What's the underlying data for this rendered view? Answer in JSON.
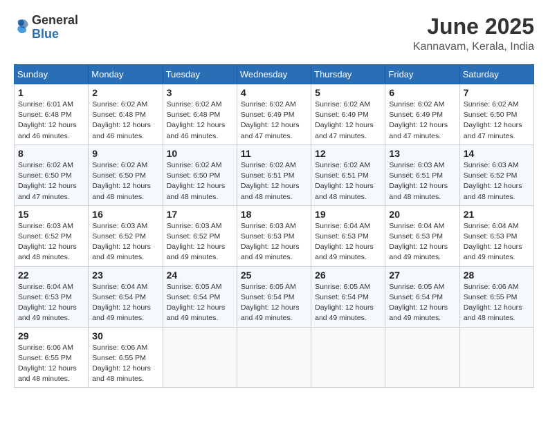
{
  "logo": {
    "general": "General",
    "blue": "Blue"
  },
  "header": {
    "month": "June 2025",
    "location": "Kannavam, Kerala, India"
  },
  "weekdays": [
    "Sunday",
    "Monday",
    "Tuesday",
    "Wednesday",
    "Thursday",
    "Friday",
    "Saturday"
  ],
  "weeks": [
    [
      {
        "day": "1",
        "info": "Sunrise: 6:01 AM\nSunset: 6:48 PM\nDaylight: 12 hours\nand 46 minutes."
      },
      {
        "day": "2",
        "info": "Sunrise: 6:02 AM\nSunset: 6:48 PM\nDaylight: 12 hours\nand 46 minutes."
      },
      {
        "day": "3",
        "info": "Sunrise: 6:02 AM\nSunset: 6:48 PM\nDaylight: 12 hours\nand 46 minutes."
      },
      {
        "day": "4",
        "info": "Sunrise: 6:02 AM\nSunset: 6:49 PM\nDaylight: 12 hours\nand 47 minutes."
      },
      {
        "day": "5",
        "info": "Sunrise: 6:02 AM\nSunset: 6:49 PM\nDaylight: 12 hours\nand 47 minutes."
      },
      {
        "day": "6",
        "info": "Sunrise: 6:02 AM\nSunset: 6:49 PM\nDaylight: 12 hours\nand 47 minutes."
      },
      {
        "day": "7",
        "info": "Sunrise: 6:02 AM\nSunset: 6:50 PM\nDaylight: 12 hours\nand 47 minutes."
      }
    ],
    [
      {
        "day": "8",
        "info": "Sunrise: 6:02 AM\nSunset: 6:50 PM\nDaylight: 12 hours\nand 47 minutes."
      },
      {
        "day": "9",
        "info": "Sunrise: 6:02 AM\nSunset: 6:50 PM\nDaylight: 12 hours\nand 48 minutes."
      },
      {
        "day": "10",
        "info": "Sunrise: 6:02 AM\nSunset: 6:50 PM\nDaylight: 12 hours\nand 48 minutes."
      },
      {
        "day": "11",
        "info": "Sunrise: 6:02 AM\nSunset: 6:51 PM\nDaylight: 12 hours\nand 48 minutes."
      },
      {
        "day": "12",
        "info": "Sunrise: 6:02 AM\nSunset: 6:51 PM\nDaylight: 12 hours\nand 48 minutes."
      },
      {
        "day": "13",
        "info": "Sunrise: 6:03 AM\nSunset: 6:51 PM\nDaylight: 12 hours\nand 48 minutes."
      },
      {
        "day": "14",
        "info": "Sunrise: 6:03 AM\nSunset: 6:52 PM\nDaylight: 12 hours\nand 48 minutes."
      }
    ],
    [
      {
        "day": "15",
        "info": "Sunrise: 6:03 AM\nSunset: 6:52 PM\nDaylight: 12 hours\nand 48 minutes."
      },
      {
        "day": "16",
        "info": "Sunrise: 6:03 AM\nSunset: 6:52 PM\nDaylight: 12 hours\nand 49 minutes."
      },
      {
        "day": "17",
        "info": "Sunrise: 6:03 AM\nSunset: 6:52 PM\nDaylight: 12 hours\nand 49 minutes."
      },
      {
        "day": "18",
        "info": "Sunrise: 6:03 AM\nSunset: 6:53 PM\nDaylight: 12 hours\nand 49 minutes."
      },
      {
        "day": "19",
        "info": "Sunrise: 6:04 AM\nSunset: 6:53 PM\nDaylight: 12 hours\nand 49 minutes."
      },
      {
        "day": "20",
        "info": "Sunrise: 6:04 AM\nSunset: 6:53 PM\nDaylight: 12 hours\nand 49 minutes."
      },
      {
        "day": "21",
        "info": "Sunrise: 6:04 AM\nSunset: 6:53 PM\nDaylight: 12 hours\nand 49 minutes."
      }
    ],
    [
      {
        "day": "22",
        "info": "Sunrise: 6:04 AM\nSunset: 6:53 PM\nDaylight: 12 hours\nand 49 minutes."
      },
      {
        "day": "23",
        "info": "Sunrise: 6:04 AM\nSunset: 6:54 PM\nDaylight: 12 hours\nand 49 minutes."
      },
      {
        "day": "24",
        "info": "Sunrise: 6:05 AM\nSunset: 6:54 PM\nDaylight: 12 hours\nand 49 minutes."
      },
      {
        "day": "25",
        "info": "Sunrise: 6:05 AM\nSunset: 6:54 PM\nDaylight: 12 hours\nand 49 minutes."
      },
      {
        "day": "26",
        "info": "Sunrise: 6:05 AM\nSunset: 6:54 PM\nDaylight: 12 hours\nand 49 minutes."
      },
      {
        "day": "27",
        "info": "Sunrise: 6:05 AM\nSunset: 6:54 PM\nDaylight: 12 hours\nand 49 minutes."
      },
      {
        "day": "28",
        "info": "Sunrise: 6:06 AM\nSunset: 6:55 PM\nDaylight: 12 hours\nand 48 minutes."
      }
    ],
    [
      {
        "day": "29",
        "info": "Sunrise: 6:06 AM\nSunset: 6:55 PM\nDaylight: 12 hours\nand 48 minutes."
      },
      {
        "day": "30",
        "info": "Sunrise: 6:06 AM\nSunset: 6:55 PM\nDaylight: 12 hours\nand 48 minutes."
      },
      {
        "day": "",
        "info": ""
      },
      {
        "day": "",
        "info": ""
      },
      {
        "day": "",
        "info": ""
      },
      {
        "day": "",
        "info": ""
      },
      {
        "day": "",
        "info": ""
      }
    ]
  ]
}
